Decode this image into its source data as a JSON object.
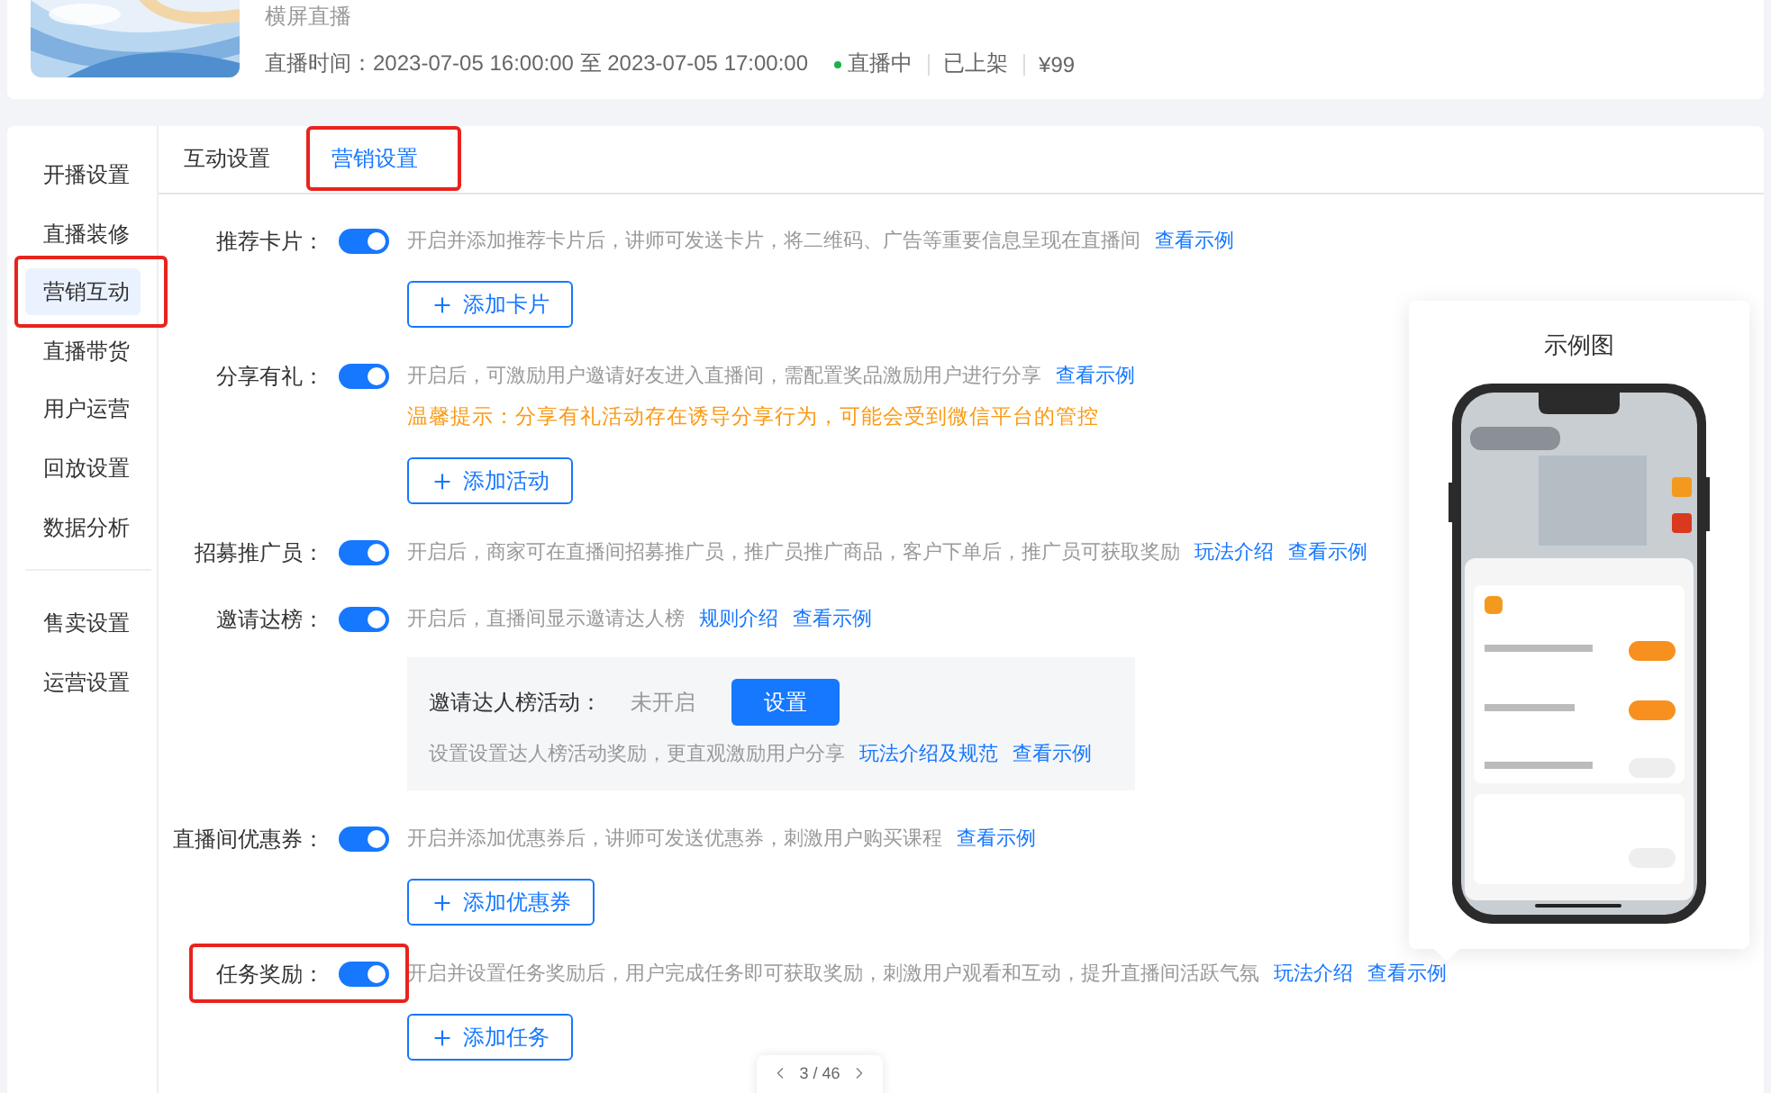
{
  "header": {
    "subtitle": "横屏直播",
    "time_label": "直播时间：",
    "time_range": "2023-07-05 16:00:00 至 2023-07-05 17:00:00",
    "status": "直播中",
    "shelf": "已上架",
    "price": "¥99"
  },
  "sidebar": {
    "groups": [
      [
        {
          "label": "开播设置",
          "selected": false,
          "highlighted": false
        },
        {
          "label": "直播装修",
          "selected": false,
          "highlighted": false
        },
        {
          "label": "营销互动",
          "selected": true,
          "highlighted": true
        },
        {
          "label": "直播带货",
          "selected": false,
          "highlighted": false
        },
        {
          "label": "用户运营",
          "selected": false,
          "highlighted": false
        },
        {
          "label": "回放设置",
          "selected": false,
          "highlighted": false
        },
        {
          "label": "数据分析",
          "selected": false,
          "highlighted": false
        }
      ],
      [
        {
          "label": "售卖设置",
          "selected": false,
          "highlighted": false
        },
        {
          "label": "运营设置",
          "selected": false,
          "highlighted": false
        }
      ]
    ]
  },
  "tabs": [
    {
      "label": "互动设置",
      "selected": false,
      "highlighted": false
    },
    {
      "label": "营销设置",
      "selected": true,
      "highlighted": true
    }
  ],
  "settings": [
    {
      "label": "推荐卡片：",
      "on": true,
      "highlighted": false,
      "description": "开启并添加推荐卡片后，讲师可发送卡片，将二维码、广告等重要信息呈现在直播间",
      "links": [
        "查看示例"
      ],
      "button": "添加卡片"
    },
    {
      "label": "分享有礼：",
      "on": true,
      "highlighted": false,
      "description": "开启后，可激励用户邀请好友进入直播间，需配置奖品激励用户进行分享",
      "links": [
        "查看示例"
      ],
      "warning": "温馨提示：分享有礼活动存在诱导分享行为，可能会受到微信平台的管控",
      "button": "添加活动"
    },
    {
      "label": "招募推广员：",
      "on": true,
      "highlighted": false,
      "description": "开启后，商家可在直播间招募推广员，推广员推广商品，客户下单后，推广员可获取奖励",
      "links": [
        "玩法介绍",
        "查看示例"
      ]
    },
    {
      "label": "邀请达榜：",
      "on": true,
      "highlighted": false,
      "description": "开启后，直播间显示邀请达人榜",
      "links": [
        "规则介绍",
        "查看示例"
      ],
      "panel": {
        "label": "邀请达人榜活动：",
        "status": "未开启",
        "button": "设置",
        "description": "设置设置达人榜活动奖励，更直观激励用户分享",
        "links": [
          "玩法介绍及规范",
          "查看示例"
        ]
      }
    },
    {
      "label": "直播间优惠券：",
      "on": true,
      "highlighted": false,
      "description": "开启并添加优惠券后，讲师可发送优惠券，刺激用户购买课程",
      "links": [
        "查看示例"
      ],
      "button": "添加优惠券"
    },
    {
      "label": "任务奖励：",
      "on": true,
      "highlighted": true,
      "description": "开启并设置任务奖励后，用户完成任务即可获取奖励，刺激用户观看和互动，提升直播间活跃气氛",
      "links": [
        "玩法介绍",
        "查看示例"
      ],
      "button": "添加任务"
    }
  ],
  "preview": {
    "title": "示例图"
  },
  "pager": {
    "text": "3 / 46"
  }
}
